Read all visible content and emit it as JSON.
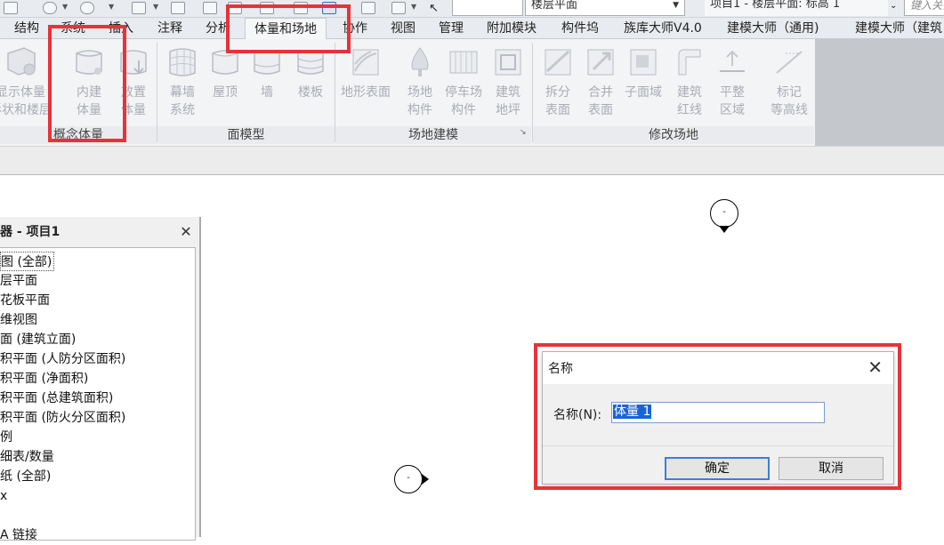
{
  "quick_access": {
    "view_dropdown_value": "楼层平面",
    "window_title": "项目1 - 楼层平面: 标高 1",
    "search_placeholder": "键入关键"
  },
  "ribbon_tabs": [
    {
      "label": "结构"
    },
    {
      "label": "系统"
    },
    {
      "label": "插入"
    },
    {
      "label": "注释"
    },
    {
      "label": "分析"
    },
    {
      "label": "体量和场地"
    },
    {
      "label": "协作"
    },
    {
      "label": "视图"
    },
    {
      "label": "管理"
    },
    {
      "label": "附加模块"
    },
    {
      "label": "构件坞"
    },
    {
      "label": "族库大师V4.0"
    },
    {
      "label": "建模大师（通用)"
    },
    {
      "label": "建模大师（建筑"
    }
  ],
  "ribbon_panels": {
    "conceptual_mass": {
      "title": "概念体量",
      "buttons": [
        {
          "label": "显示体量\n形状和楼层"
        },
        {
          "label": "内建\n体量"
        },
        {
          "label": "放置\n体量"
        }
      ]
    },
    "model_by_face": {
      "title": "面模型",
      "buttons": [
        {
          "label": "幕墙\n系统"
        },
        {
          "label": "屋顶"
        },
        {
          "label": "墙"
        },
        {
          "label": "楼板"
        }
      ]
    },
    "site_modeling": {
      "title": "场地建模",
      "buttons": [
        {
          "label": "地形表面"
        },
        {
          "label": "场地\n构件"
        },
        {
          "label": "停车场\n构件"
        },
        {
          "label": "建筑\n地坪"
        }
      ]
    },
    "modify_site": {
      "title": "修改场地",
      "buttons": [
        {
          "label": "拆分\n表面"
        },
        {
          "label": "合并\n表面"
        },
        {
          "label": "子面域"
        },
        {
          "label": "建筑\n红线"
        },
        {
          "label": "平整\n区域"
        },
        {
          "label": "标记\n等高线"
        }
      ]
    }
  },
  "project_browser": {
    "title": "器 - 项目1",
    "items": [
      {
        "label": "图 (全部)"
      },
      {
        "label": "层平面"
      },
      {
        "label": "花板平面"
      },
      {
        "label": "维视图"
      },
      {
        "label": "面 (建筑立面)"
      },
      {
        "label": "积平面 (人防分区面积)"
      },
      {
        "label": "积平面 (净面积)"
      },
      {
        "label": "积平面 (总建筑面积)"
      },
      {
        "label": "积平面 (防火分区面积)"
      },
      {
        "label": "例"
      },
      {
        "label": "细表/数量"
      },
      {
        "label": "纸 (全部)"
      },
      {
        "label": "x"
      },
      {
        "label": "A 链接"
      }
    ]
  },
  "dialog": {
    "title": "名称",
    "field_label": "名称(N):",
    "field_value": "体量 1",
    "ok_label": "确定",
    "cancel_label": "取消"
  },
  "canvas_markers": [
    {
      "label": "-"
    },
    {
      "label": "-"
    }
  ],
  "colors": {
    "highlight": "#e8323a",
    "selection": "#1a63d6"
  }
}
